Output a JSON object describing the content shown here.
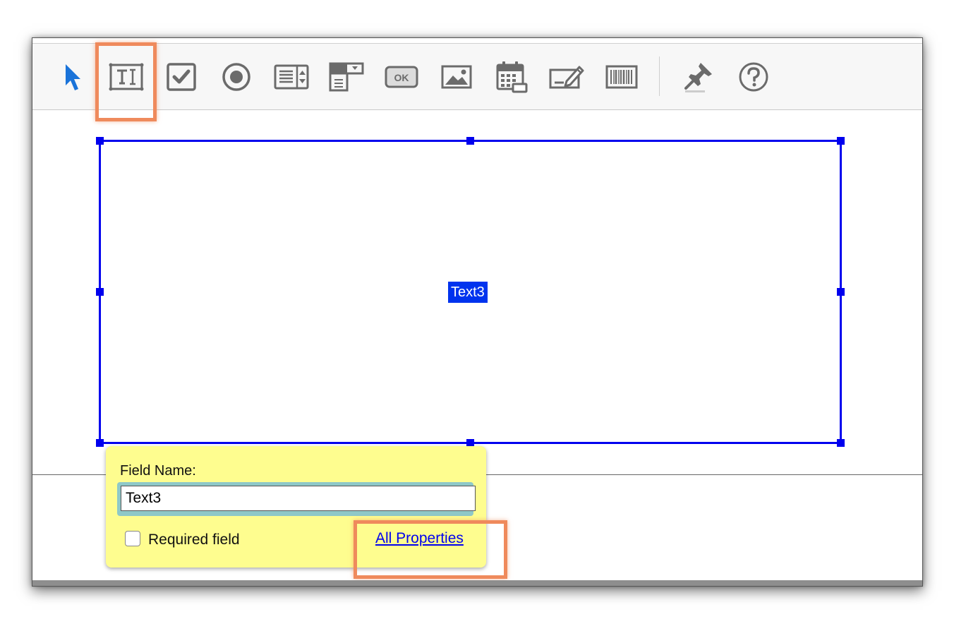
{
  "toolbar": {
    "tools": [
      {
        "name": "select-tool",
        "icon": "arrow-cursor-icon"
      },
      {
        "name": "text-field-tool",
        "icon": "text-field-icon",
        "highlighted": true
      },
      {
        "name": "check-box-tool",
        "icon": "checkbox-icon"
      },
      {
        "name": "radio-button-tool",
        "icon": "radio-button-icon"
      },
      {
        "name": "list-box-tool",
        "icon": "list-box-icon"
      },
      {
        "name": "dropdown-tool",
        "icon": "dropdown-icon"
      },
      {
        "name": "button-tool",
        "icon": "button-icon",
        "label": "OK"
      },
      {
        "name": "image-field-tool",
        "icon": "image-icon"
      },
      {
        "name": "date-field-tool",
        "icon": "calendar-icon"
      },
      {
        "name": "signature-tool",
        "icon": "signature-pen-icon"
      },
      {
        "name": "barcode-tool",
        "icon": "barcode-icon"
      },
      {
        "name": "keep-tool-selected",
        "icon": "pushpin-icon"
      },
      {
        "name": "help",
        "icon": "help-question-icon"
      }
    ],
    "button_icon_label": "OK"
  },
  "field": {
    "name": "Text3",
    "selection_color": "#0000ee"
  },
  "popup": {
    "field_name_label": "Field Name:",
    "field_name_value": "Text3",
    "required_label": "Required field",
    "required_checked": false,
    "all_properties_link": "All Properties",
    "background": "#fefd8f"
  },
  "colors": {
    "highlight": "#ef8a5c",
    "cursor_blue": "#1a73d9",
    "icon_gray": "#6b6b6b"
  }
}
